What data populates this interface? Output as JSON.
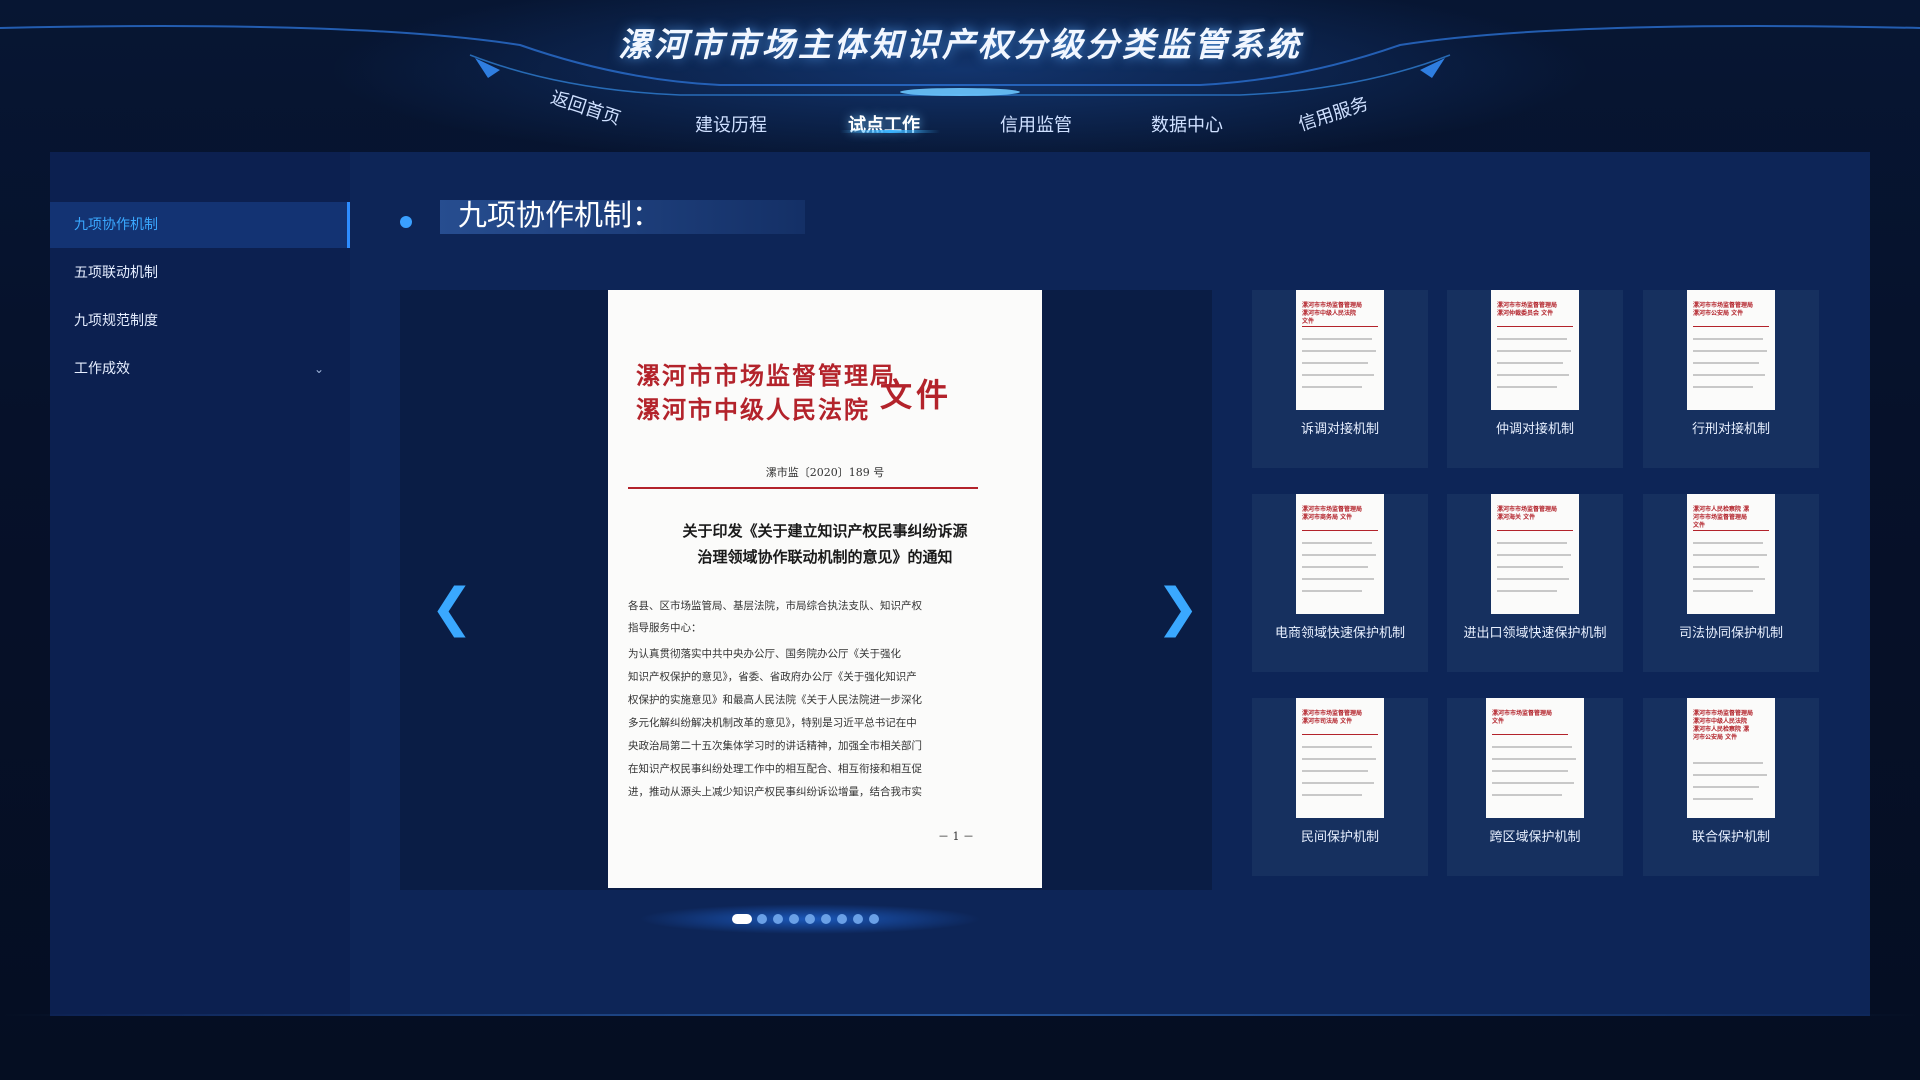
{
  "header": {
    "title": "漯河市市场主体知识产权分级分类监管系统",
    "nav": [
      {
        "label": "返回首页",
        "active": false
      },
      {
        "label": "建设历程",
        "active": false
      },
      {
        "label": "试点工作",
        "active": true
      },
      {
        "label": "信用监管",
        "active": false
      },
      {
        "label": "数据中心",
        "active": false
      },
      {
        "label": "信用服务",
        "active": false
      }
    ]
  },
  "sidebar": {
    "items": [
      {
        "label": "九项协作机制",
        "active": true
      },
      {
        "label": "五项联动机制",
        "active": false
      },
      {
        "label": "九项规范制度",
        "active": false
      },
      {
        "label": "工作成效",
        "active": false,
        "has_submenu": true
      }
    ]
  },
  "section": {
    "title": "九项协作机制："
  },
  "document": {
    "issuer_line1": "漯河市市场监督管理局",
    "issuer_line2": "漯河市中级人民法院",
    "file_mark": "文件",
    "number": "漯市监〔2020〕189 号",
    "headline_line1": "关于印发《关于建立知识产权民事纠纷诉源",
    "headline_line2": "治理领域协作联动机制的意见》的通知",
    "body": [
      "各县、区市场监管局、基层法院，市局综合执法支队、知识产权",
      "指导服务中心：",
      "    为认真贯彻落实中共中央办公厅、国务院办公厅《关于强化",
      "知识产权保护的意见》，省委、省政府办公厅《关于强化知识产",
      "权保护的实施意见》和最高人民法院《关于人民法院进一步深化",
      "多元化解纠纷解决机制改革的意见》，特别是习近平总书记在中",
      "央政治局第二十五次集体学习时的讲话精神，加强全市相关部门",
      "在知识产权民事纠纷处理工作中的相互配合、相互衔接和相互促",
      "进，推动从源头上减少知识产权民事纠纷诉讼增量，结合我市实"
    ],
    "page_number": "－ 1 －"
  },
  "carousel": {
    "prev_icon": "chevron-left-icon",
    "next_icon": "chevron-right-icon",
    "prev_glyph": "❮",
    "next_glyph": "❯",
    "slide_count": 9,
    "active_index": 0
  },
  "thumbnails": [
    {
      "label": "诉调对接机制",
      "doc_head": "漯河市市场监督管理局 漯河市中级人民法院 文件"
    },
    {
      "label": "仲调对接机制",
      "doc_head": "漯河市市场监督管理局 漯河仲裁委员会 文件"
    },
    {
      "label": "行刑对接机制",
      "doc_head": "漯河市市场监督管理局 漯河市公安局 文件"
    },
    {
      "label": "电商领域快速保护机制",
      "doc_head": "漯河市市场监督管理局 漯河市商务局 文件"
    },
    {
      "label": "进出口领域快速保护机制",
      "doc_head": "漯河市市场监督管理局 漯河海关 文件"
    },
    {
      "label": "司法协同保护机制",
      "doc_head": "漯河市人民检察院 漯河市市场监督管理局 文件"
    },
    {
      "label": "民间保护机制",
      "doc_head": "漯河市市场监督管理局 漯河市司法局 文件"
    },
    {
      "label": "跨区域保护机制",
      "doc_head": "漯河市市场监督管理局文件"
    },
    {
      "label": "联合保护机制",
      "doc_head": "漯河市市场监督管理局 漯河市中级人民法院 漯河市人民检察院 漯河市公安局 文件"
    }
  ],
  "colors": {
    "accent": "#3aa8ff",
    "panel": "#0d2557",
    "sidebar": "#0c2050",
    "doc_red": "#b3232b"
  }
}
